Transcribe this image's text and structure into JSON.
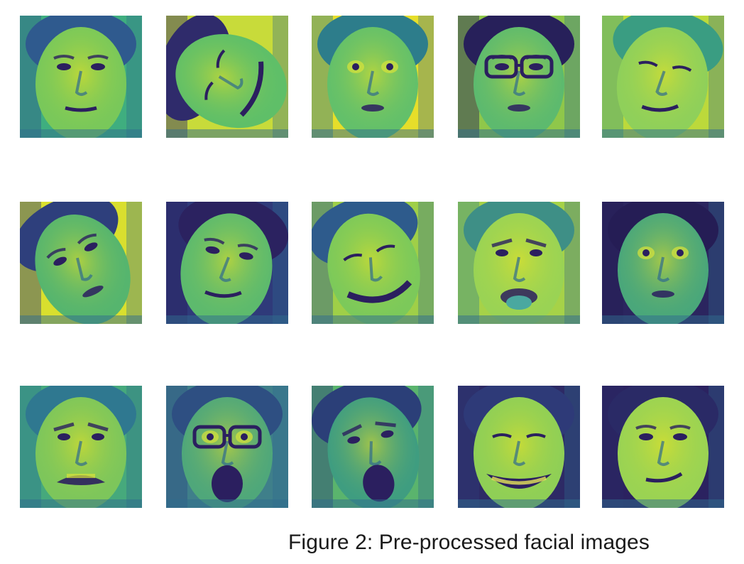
{
  "caption": "Figure 2: Pre-processed facial images",
  "colormap": {
    "low": "#2b1f5f",
    "mid_low": "#2f6b8e",
    "mid": "#2a9a87",
    "mid_high": "#6cc25a",
    "high": "#f2e51f"
  },
  "faces": [
    {
      "name": "face-man-neutral",
      "bg": "#3fae7f",
      "skin": "#79c85a",
      "hair": "#2f5a8e",
      "mouth": "open-small",
      "eyes": "normal",
      "tilt": 0,
      "glasses": false
    },
    {
      "name": "face-warped-sideways",
      "bg": "#c8db3a",
      "skin": "#5fbf68",
      "hair": "#2f2b6b",
      "mouth": "wide",
      "eyes": "squint",
      "tilt": -70,
      "glasses": false
    },
    {
      "name": "face-woman-surprised",
      "bg": "#e6de2a",
      "skin": "#63c06a",
      "hair": "#2d7d8b",
      "mouth": "small",
      "eyes": "wide",
      "tilt": 0,
      "glasses": false
    },
    {
      "name": "face-man-glasses",
      "bg": "#8fc74a",
      "skin": "#5dba6e",
      "hair": "#27205a",
      "mouth": "small",
      "eyes": "normal",
      "tilt": 0,
      "glasses": true
    },
    {
      "name": "face-smirk-closeup",
      "bg": "#bcd93b",
      "skin": "#8fd05a",
      "hair": "#3a9d82",
      "mouth": "smirk",
      "eyes": "squint",
      "tilt": 8,
      "glasses": false
    },
    {
      "name": "face-tilted-woman",
      "bg": "#d9df2e",
      "skin": "#56b56e",
      "hair": "#2e3f7c",
      "mouth": "small",
      "eyes": "normal",
      "tilt": -25,
      "glasses": false
    },
    {
      "name": "face-woman-dark-hair",
      "bg": "#2f3a7a",
      "skin": "#5dba6d",
      "hair": "#2b2260",
      "mouth": "smirk",
      "eyes": "normal",
      "tilt": 10,
      "glasses": false
    },
    {
      "name": "face-grimace-distorted",
      "bg": "#9fcf48",
      "skin": "#7cc95a",
      "hair": "#2e5b8c",
      "mouth": "grimace",
      "eyes": "squint",
      "tilt": -15,
      "glasses": false
    },
    {
      "name": "face-tongue-out",
      "bg": "#a6d248",
      "skin": "#9ad354",
      "hair": "#3e8f86",
      "mouth": "tongue",
      "eyes": "frown",
      "tilt": 0,
      "glasses": false
    },
    {
      "name": "face-bearded-surprised",
      "bg": "#2b255f",
      "skin": "#4aa77a",
      "hair": "#251d55",
      "mouth": "small",
      "eyes": "wide",
      "tilt": 0,
      "glasses": false
    },
    {
      "name": "face-child-crying",
      "bg": "#46a97c",
      "skin": "#7dc65b",
      "hair": "#2f7890",
      "mouth": "cry",
      "eyes": "frown",
      "tilt": 0,
      "glasses": false
    },
    {
      "name": "face-shocked-glasses",
      "bg": "#3f7f8a",
      "skin": "#4fa77a",
      "hair": "#2e4f82",
      "mouth": "scream",
      "eyes": "wide",
      "tilt": 0,
      "glasses": true
    },
    {
      "name": "face-screaming",
      "bg": "#5ab46d",
      "skin": "#3f9d80",
      "hair": "#2b3f78",
      "mouth": "scream",
      "eyes": "frown",
      "tilt": -10,
      "glasses": false
    },
    {
      "name": "face-laughing",
      "bg": "#2d2a65",
      "skin": "#8fcf56",
      "hair": "#2e3a78",
      "mouth": "grin",
      "eyes": "squint",
      "tilt": 0,
      "glasses": false
    },
    {
      "name": "face-woman-smirk",
      "bg": "#2b2260",
      "skin": "#9ad353",
      "hair": "#2a2a66",
      "mouth": "smirk",
      "eyes": "normal",
      "tilt": 0,
      "glasses": false
    }
  ]
}
